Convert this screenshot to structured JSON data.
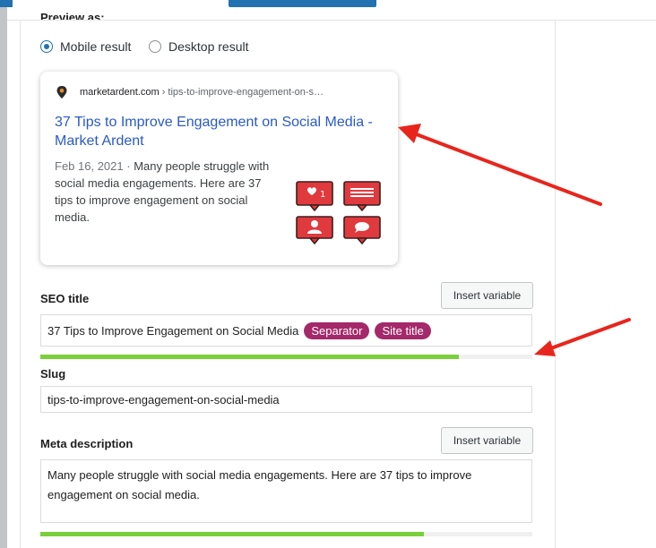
{
  "preview": {
    "label": "Preview as:",
    "options": [
      {
        "label": "Mobile result",
        "checked": true
      },
      {
        "label": "Desktop result",
        "checked": false
      }
    ]
  },
  "snippet": {
    "site": "marketardent.com",
    "path": " › tips-to-improve-engagement-on-s…",
    "title": "37 Tips to Improve Engagement on Social Media - Market Ardent",
    "date": "Feb 16, 2021",
    "separator": " · ",
    "description": "Many people struggle with social media engagements. Here are 37 tips to improve engagement on social media.",
    "thumbnail_badge": "1"
  },
  "seo_title": {
    "label": "SEO title",
    "insert_button": "Insert variable",
    "value": "37 Tips to Improve Engagement on Social Media",
    "pills": [
      "Separator",
      "Site title"
    ],
    "progress": 0.85
  },
  "slug": {
    "label": "Slug",
    "value": "tips-to-improve-engagement-on-social-media"
  },
  "meta_description": {
    "label": "Meta description",
    "insert_button": "Insert variable",
    "value": "Many people struggle with social media engagements. Here are 37 tips to improve engagement on social media.",
    "progress": 0.78
  },
  "colors": {
    "accent": "#2271b1",
    "link": "#2a5ac7",
    "pill": "#a4286a",
    "progress_good": "#7ad03a",
    "annotation_arrow": "#e8251c",
    "notification_red": "#e0393e"
  }
}
